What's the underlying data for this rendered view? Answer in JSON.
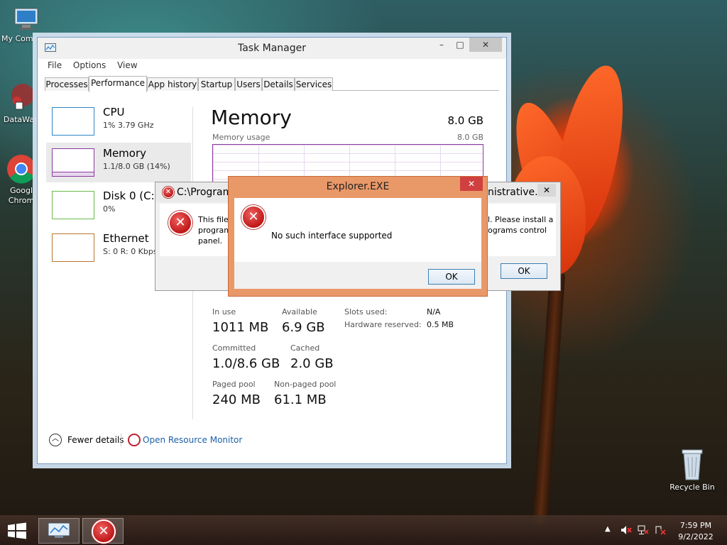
{
  "desktop_icons": [
    {
      "label": "My Comp",
      "icon": "computer-icon"
    },
    {
      "label": "DataWag",
      "icon": "datawag-icon"
    },
    {
      "label": "Googl Chrom",
      "icon": "chrome-icon"
    },
    {
      "label": "Recycle Bin",
      "icon": "recycle-bin-icon"
    }
  ],
  "task_manager": {
    "title": "Task Manager",
    "window_buttons": {
      "minimize": "–",
      "maximize": "□",
      "close": "✕"
    },
    "menu": [
      "File",
      "Options",
      "View"
    ],
    "tabs": [
      "Processes",
      "Performance",
      "App history",
      "Startup",
      "Users",
      "Details",
      "Services"
    ],
    "active_tab": "Performance",
    "sidebar": [
      {
        "name": "CPU",
        "sub": "1% 3.79 GHz",
        "color": "#2f86c6"
      },
      {
        "name": "Memory",
        "sub": "1.1/8.0 GB (14%)",
        "color": "#8b3a9f"
      },
      {
        "name": "Disk 0 (C:)",
        "sub": "0%",
        "color": "#6ab94a"
      },
      {
        "name": "Ethernet",
        "sub": "S: 0 R: 0 Kbps",
        "color": "#b8762e"
      }
    ],
    "memory": {
      "title": "Memory",
      "capacity": "8.0 GB",
      "usage_label": "Memory usage",
      "usage_max": "8.0 GB",
      "in_use_label": "In use",
      "in_use": "1011 MB",
      "available_label": "Available",
      "available": "6.9 GB",
      "committed_label": "Committed",
      "committed": "1.0/8.6 GB",
      "cached_label": "Cached",
      "cached": "2.0 GB",
      "paged_label": "Paged pool",
      "paged": "240 MB",
      "nonpaged_label": "Non-paged pool",
      "nonpaged": "61.1 MB",
      "slots_label": "Slots used:",
      "slots": "N/A",
      "hw_reserved_label": "Hardware reserved:",
      "hw_reserved": "0.5 MB"
    },
    "footer": {
      "fewer_details": "Fewer details",
      "open_resource_monitor": "Open Resource Monitor"
    }
  },
  "back_dialog": {
    "title_left": "C:\\Program",
    "title_right": "nistrative...",
    "close": "✕",
    "text_left_1": "This file",
    "text_left_2": "program",
    "text_left_3": "panel.",
    "text_right_1": "l. Please install a",
    "text_right_2": "ograms control",
    "ok": "OK"
  },
  "front_dialog": {
    "title": "Explorer.EXE",
    "close": "✕",
    "message": "No such interface supported",
    "ok": "OK"
  },
  "taskbar": {
    "time": "7:59 PM",
    "date": "9/2/2022",
    "tray_arrow": "▲"
  }
}
